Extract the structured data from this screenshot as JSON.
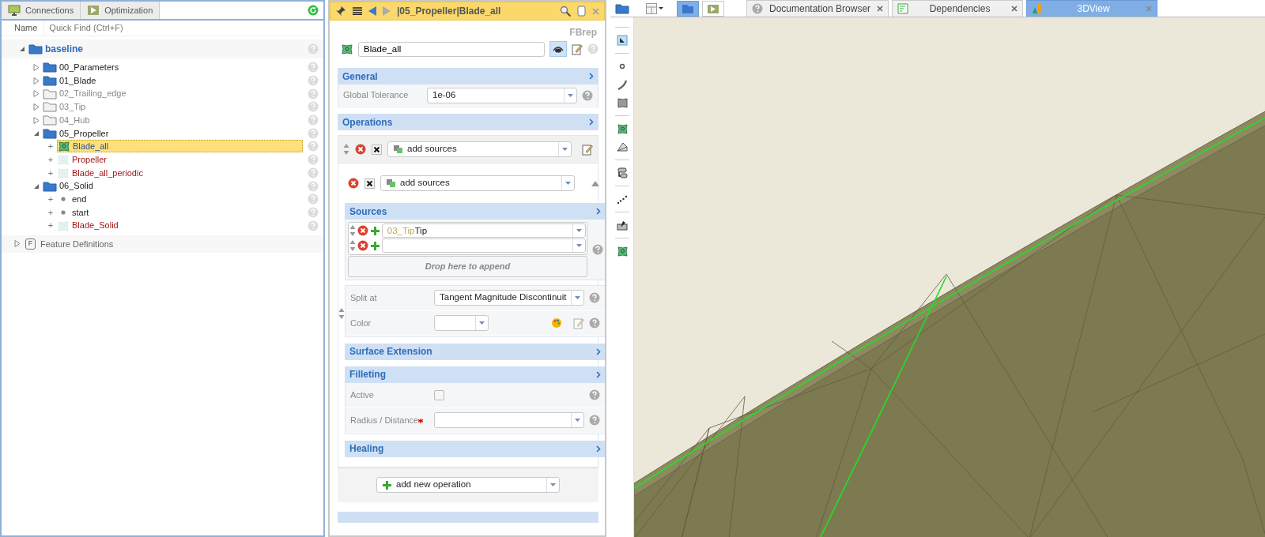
{
  "explorer": {
    "tabs": [
      {
        "label": "Connections",
        "selected": false
      },
      {
        "label": "Optimization",
        "selected": false
      }
    ],
    "columns": {
      "name": "Name",
      "placeholder": "Quick Find (Ctrl+F)"
    },
    "tree": [
      {
        "label": "baseline",
        "kind": "root",
        "expanded": true,
        "children": [
          {
            "label": "00_Parameters",
            "kind": "folder",
            "enabled": true,
            "expanded": false
          },
          {
            "label": "01_Blade",
            "kind": "folder",
            "enabled": true,
            "expanded": false
          },
          {
            "label": "02_Trailing_edge",
            "kind": "folder",
            "enabled": false,
            "expanded": false
          },
          {
            "label": "03_Tip",
            "kind": "folder",
            "enabled": false,
            "expanded": false
          },
          {
            "label": "04_Hub",
            "kind": "folder",
            "enabled": false,
            "expanded": false
          },
          {
            "label": "05_Propeller",
            "kind": "folder",
            "enabled": true,
            "expanded": true,
            "children": [
              {
                "label": "Blade_all",
                "kind": "feature",
                "toggle": "+",
                "valid": true,
                "selected": true
              },
              {
                "label": "Propeller",
                "kind": "feature",
                "toggle": "+",
                "valid": false,
                "selected": false
              },
              {
                "label": "Blade_all_periodic",
                "kind": "feature",
                "toggle": "+",
                "valid": false,
                "selected": false
              }
            ]
          },
          {
            "label": "06_Solid",
            "kind": "folder",
            "enabled": true,
            "expanded": true,
            "children": [
              {
                "label": "end",
                "kind": "point",
                "toggle": "+"
              },
              {
                "label": "start",
                "kind": "point",
                "toggle": "+"
              },
              {
                "label": "Blade_Solid",
                "kind": "feature",
                "toggle": "+",
                "valid": false,
                "selected": false
              }
            ]
          }
        ]
      }
    ],
    "definitions": {
      "label": "Feature Definitions",
      "letter": "F",
      "expanded": false
    }
  },
  "editor": {
    "path": "|05_Propeller|Blade_all",
    "type": "FBrep",
    "name": "Blade_all",
    "visible": true,
    "general": {
      "title": "General",
      "fields": [
        {
          "label": "Global Tolerance",
          "value": "1e-06"
        }
      ]
    },
    "operations": {
      "title": "Operations",
      "items": [
        {
          "value": "add sources"
        }
      ],
      "detail": {
        "value": "add sources",
        "sections": [
          {
            "title": "Sources",
            "kind": "list",
            "rows": [
              {
                "prefix": "03_Tip",
                "value": "Tip"
              },
              {}
            ],
            "drop_hint": "Drop here to append"
          },
          {
            "kind": "fields",
            "fields": [
              {
                "label": "Split at",
                "kind": "select",
                "value": "Tangent Magnitude Discontinuit"
              },
              {
                "label": "Color",
                "kind": "color"
              }
            ]
          },
          {
            "title": "Surface Extension",
            "kind": "header"
          },
          {
            "title": "Filleting",
            "kind": "fields",
            "fields": [
              {
                "label": "Active",
                "kind": "check",
                "checked": false
              },
              {
                "label": "Radius / Distance",
                "kind": "select",
                "required": true
              }
            ]
          },
          {
            "title": "Healing",
            "kind": "header"
          }
        ]
      },
      "add_button": "add new operation"
    }
  },
  "workspace": {
    "tools": [
      {
        "selected": true
      },
      {
        "selected": false
      }
    ],
    "tabs": [
      {
        "label": "Documentation Browser",
        "selected": false
      },
      {
        "label": "Dependencies",
        "selected": false
      },
      {
        "label": "3DView",
        "selected": true
      }
    ]
  }
}
